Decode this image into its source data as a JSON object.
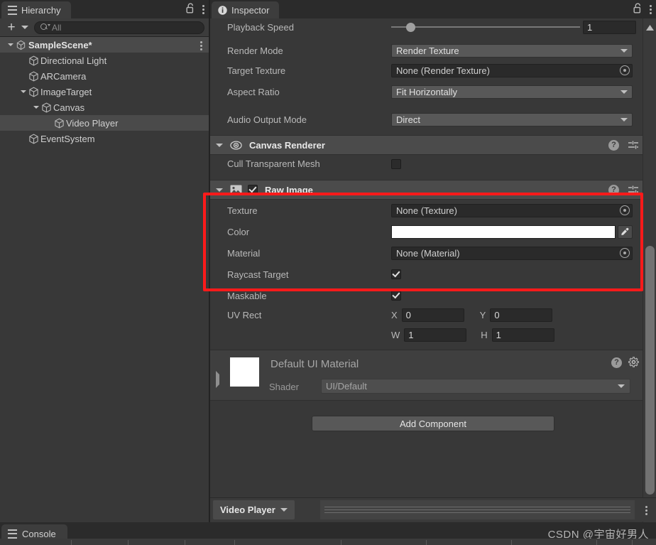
{
  "hierarchy": {
    "tab_label": "Hierarchy",
    "tab_icon": "hierarchy-icon",
    "lock_icon": "lock-open-icon",
    "menu_icon": "kebab-menu-icon",
    "create_label": "+",
    "search_placeholder": "All",
    "items": [
      {
        "label": "SampleScene*",
        "depth": 0,
        "icon": "unity-scene-icon",
        "expanded": true,
        "selected": false,
        "bold": true
      },
      {
        "label": "Directional Light",
        "depth": 1,
        "icon": "gameobject-cube-icon",
        "expanded": null,
        "selected": false,
        "bold": false
      },
      {
        "label": "ARCamera",
        "depth": 1,
        "icon": "gameobject-cube-icon",
        "expanded": null,
        "selected": false,
        "bold": false
      },
      {
        "label": "ImageTarget",
        "depth": 1,
        "icon": "gameobject-cube-icon",
        "expanded": true,
        "selected": false,
        "bold": false
      },
      {
        "label": "Canvas",
        "depth": 2,
        "icon": "gameobject-cube-icon",
        "expanded": true,
        "selected": false,
        "bold": false
      },
      {
        "label": "Video Player",
        "depth": 3,
        "icon": "gameobject-cube-icon",
        "expanded": null,
        "selected": true,
        "bold": false
      },
      {
        "label": "EventSystem",
        "depth": 1,
        "icon": "gameobject-cube-icon",
        "expanded": null,
        "selected": false,
        "bold": false
      }
    ]
  },
  "inspector": {
    "tab_label": "Inspector",
    "tab_icon": "info-icon",
    "lock_icon": "lock-open-icon",
    "menu_icon": "kebab-menu-icon",
    "video_player": {
      "playback_speed": {
        "label": "Playback Speed",
        "value": "1",
        "slider_percent": 10
      },
      "render_mode": {
        "label": "Render Mode",
        "value": "Render Texture"
      },
      "target_texture": {
        "label": "Target Texture",
        "value": "None (Render Texture)"
      },
      "aspect_ratio": {
        "label": "Aspect Ratio",
        "value": "Fit Horizontally"
      },
      "audio_output_mode": {
        "label": "Audio Output Mode",
        "value": "Direct"
      }
    },
    "canvas_renderer": {
      "title": "Canvas Renderer",
      "icon": "canvas-renderer-eye-icon",
      "expanded": true,
      "cull_transparent_mesh": {
        "label": "Cull Transparent Mesh",
        "checked": false
      }
    },
    "raw_image": {
      "title": "Raw Image",
      "icon": "raw-image-icon",
      "expanded": true,
      "enabled": true,
      "texture": {
        "label": "Texture",
        "value": "None (Texture)"
      },
      "color": {
        "label": "Color",
        "value": "#FFFFFF"
      },
      "material": {
        "label": "Material",
        "value": "None (Material)"
      },
      "raycast_target": {
        "label": "Raycast Target",
        "checked": true
      },
      "maskable": {
        "label": "Maskable",
        "checked": true
      },
      "uv_rect": {
        "label": "UV Rect",
        "x_label": "X",
        "x_value": "0",
        "y_label": "Y",
        "y_value": "0",
        "w_label": "W",
        "w_value": "1",
        "h_label": "H",
        "h_value": "1"
      }
    },
    "material_preview": {
      "title": "Default UI Material",
      "shader_label": "Shader",
      "shader_value": "UI/Default",
      "help_icon": "help-icon",
      "settings_icon": "gear-icon"
    },
    "add_component_label": "Add Component",
    "highlight_color": "#ff1a1a"
  },
  "bottom": {
    "video_player_tab": "Video Player",
    "console_tab": "Console",
    "console_icon": "console-list-icon",
    "watermark": "CSDN @宇宙好男人"
  }
}
